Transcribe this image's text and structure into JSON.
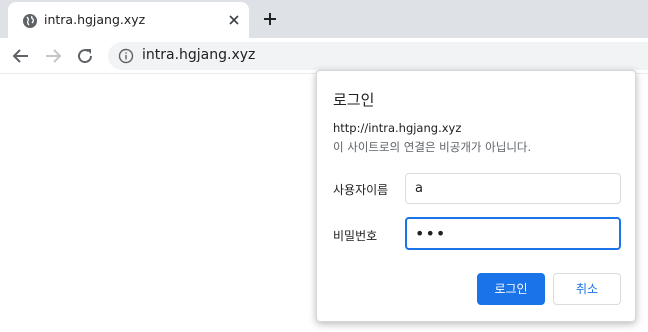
{
  "tab": {
    "title": "intra.hgjang.xyz",
    "favicon": "globe-icon",
    "close_icon": "close-icon"
  },
  "new_tab_icon": "plus-icon",
  "toolbar": {
    "back_icon": "arrow-left-icon",
    "forward_icon": "arrow-right-icon",
    "reload_icon": "reload-icon",
    "security_icon": "info-icon",
    "url": "intra.hgjang.xyz"
  },
  "dialog": {
    "title": "로그인",
    "origin": "http://intra.hgjang.xyz",
    "warning": "이 사이트로의 연결은 비공개가 아닙니다.",
    "username_label": "사용자이름",
    "username_value": "a",
    "password_label": "비밀번호",
    "password_value": "•••",
    "login_button": "로그인",
    "cancel_button": "취소"
  },
  "colors": {
    "accent": "#1a73e8",
    "tabstrip": "#dee1e6",
    "omnibox": "#f1f3f4"
  }
}
